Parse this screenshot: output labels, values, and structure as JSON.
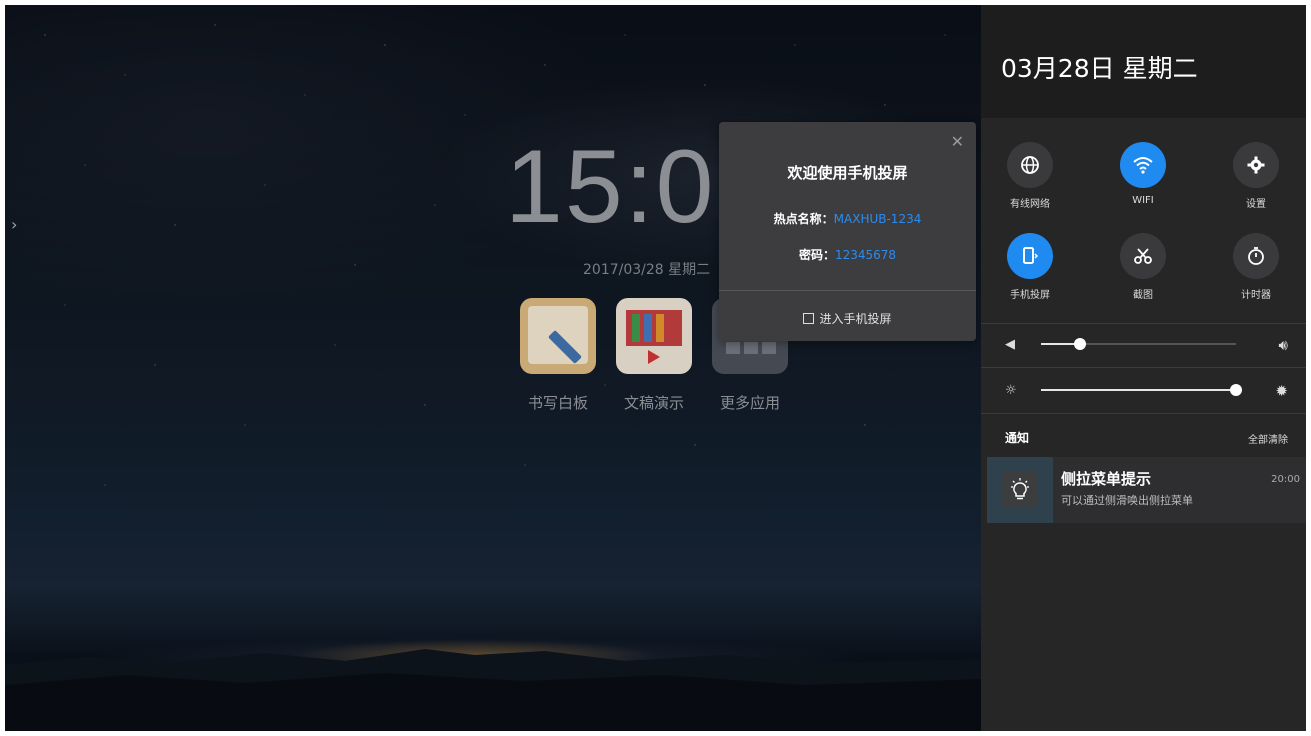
{
  "home": {
    "clock": "15:0",
    "date": "2017/03/28 星期二",
    "apps": [
      {
        "label": "书写白板"
      },
      {
        "label": "文稿演示"
      },
      {
        "label": "更多应用"
      }
    ]
  },
  "popup": {
    "title": "欢迎使用手机投屏",
    "hotspot_label": "热点名称：",
    "hotspot_value": "MAXHUB-1234",
    "password_label": "密码：",
    "password_value": "12345678",
    "enter_label": "进入手机投屏"
  },
  "panel": {
    "date": "03月28日 星期二",
    "quick_settings": [
      {
        "label": "有线网络",
        "icon": "globe-icon",
        "active": false
      },
      {
        "label": "WIFI",
        "icon": "wifi-icon",
        "active": true
      },
      {
        "label": "设置",
        "icon": "gear-icon",
        "active": false
      },
      {
        "label": "手机投屏",
        "icon": "phone-cast-icon",
        "active": true
      },
      {
        "label": "截图",
        "icon": "scissors-icon",
        "active": false
      },
      {
        "label": "计时器",
        "icon": "timer-icon",
        "active": false
      }
    ],
    "volume_level": 0.2,
    "brightness_level": 1.0,
    "notifications_title": "通知",
    "clear_all": "全部清除",
    "notification": {
      "title": "侧拉菜单提示",
      "body": "可以通过侧滑唤出侧拉菜单",
      "time": "20:00",
      "icon": "lightbulb-icon"
    }
  },
  "colors": {
    "accent": "#1f8bf0",
    "panel_bg": "#262627",
    "popup_bg": "#3d3d3f"
  }
}
